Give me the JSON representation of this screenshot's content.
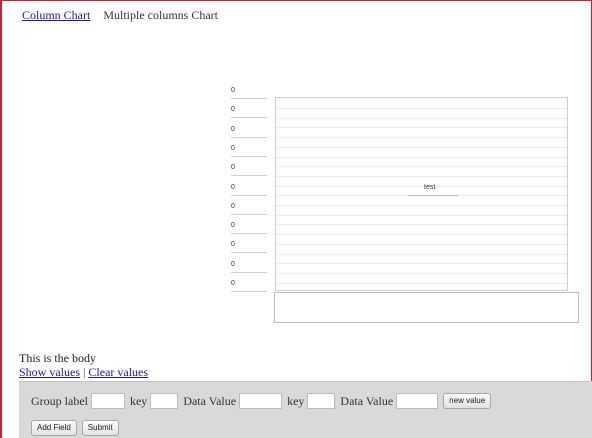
{
  "nav": {
    "column_chart_link": "Column Chart",
    "multiple_columns_label": "Multiple columns Chart"
  },
  "chart": {
    "row_labels": [
      "0",
      "0",
      "0",
      "0",
      "0",
      "0",
      "0",
      "0",
      "0",
      "0",
      "0"
    ],
    "series_label": "test"
  },
  "body": {
    "text": "This is the body",
    "show_values_link": "Show values",
    "separator": "|",
    "clear_values_link": "Clear values"
  },
  "form": {
    "group_label": "Group label",
    "group_value": "",
    "key1_label": "key",
    "key1_value": "",
    "data_value1_label": "Data Value",
    "data_value1_value": "",
    "key2_label": "key",
    "key2_value": "",
    "data_value2_label": "Data Value",
    "data_value2_value": "",
    "new_value_button": "new value",
    "add_field_button": "Add Field",
    "submit_button": "Submit"
  },
  "colors": {
    "frame": "#cc2233",
    "link": "#1a1aa6",
    "panel": "#d9d9d9"
  }
}
